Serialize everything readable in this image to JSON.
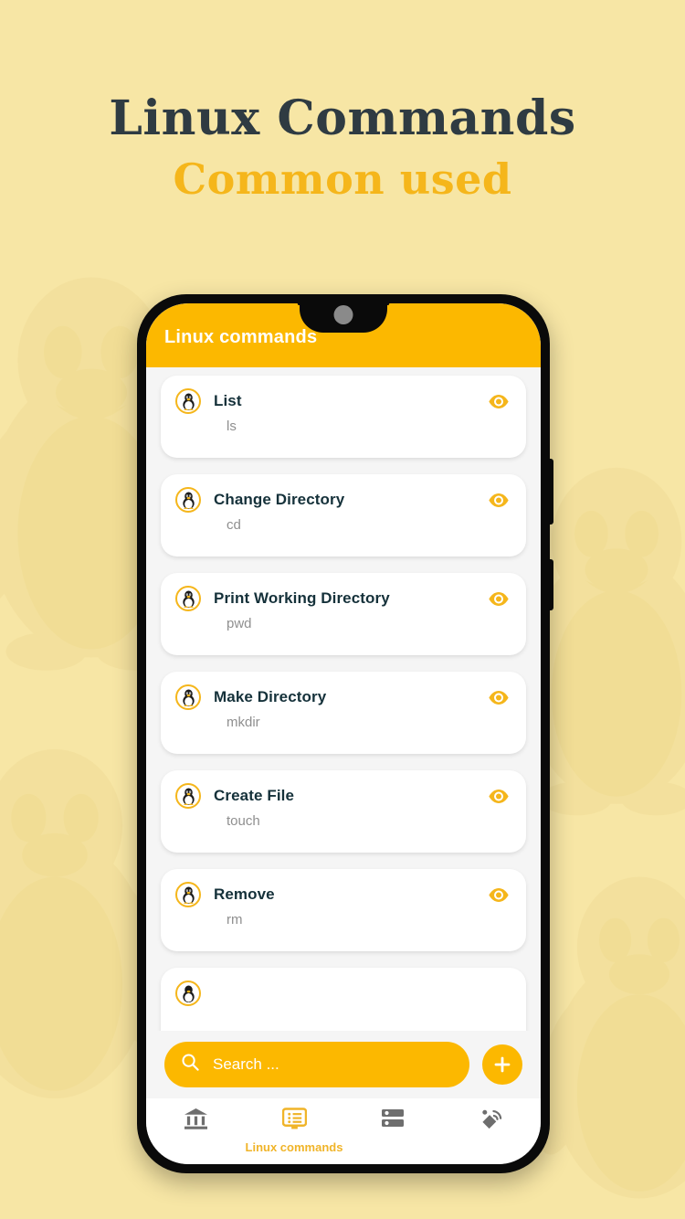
{
  "hero": {
    "title": "Linux Commands",
    "subtitle": "Common used",
    "title_color": "#2f3b42",
    "subtitle_color": "#f5b61b"
  },
  "theme": {
    "page_background": "#f7e6a5",
    "accent": "#fcb800",
    "accent_dark": "#f5b61b",
    "screen_background": "#f5f5f5",
    "card_background": "#ffffff",
    "title_text": "#15313a",
    "subtitle_text": "#8f8f8f",
    "nav_inactive": "#6e6e6e"
  },
  "app": {
    "appbar": {
      "title": "Linux commands",
      "icon": "waterdrop-notch",
      "camera_icon": "front-camera"
    },
    "commands": [
      {
        "name": "List",
        "command": "ls",
        "avatar_icon": "tux-penguin-icon",
        "action_icon": "eye-icon"
      },
      {
        "name": "Change Directory",
        "command": "cd",
        "avatar_icon": "tux-penguin-icon",
        "action_icon": "eye-icon"
      },
      {
        "name": "Print Working Directory",
        "command": "pwd",
        "avatar_icon": "tux-penguin-icon",
        "action_icon": "eye-icon"
      },
      {
        "name": "Make Directory",
        "command": "mkdir",
        "avatar_icon": "tux-penguin-icon",
        "action_icon": "eye-icon"
      },
      {
        "name": "Create File",
        "command": "touch",
        "avatar_icon": "tux-penguin-icon",
        "action_icon": "eye-icon"
      },
      {
        "name": "Remove",
        "command": "rm",
        "avatar_icon": "tux-penguin-icon",
        "action_icon": "eye-icon"
      }
    ],
    "search": {
      "placeholder": "Search ...",
      "icon": "search-icon"
    },
    "fab": {
      "label": "+",
      "icon": "plus-icon"
    },
    "bottom_nav": [
      {
        "label": "",
        "icon": "bank-icon",
        "active": false
      },
      {
        "label": "Linux commands",
        "icon": "monitor-list-icon",
        "active": true
      },
      {
        "label": "",
        "icon": "server-icon",
        "active": false
      },
      {
        "label": "",
        "icon": "satellite-icon",
        "active": false
      }
    ]
  }
}
